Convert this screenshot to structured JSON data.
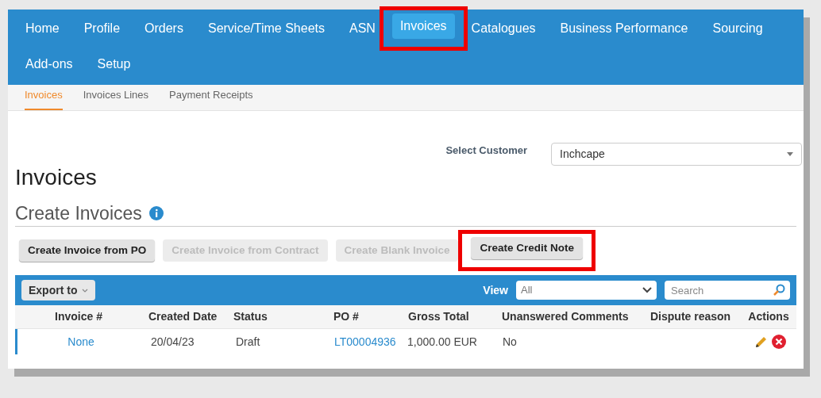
{
  "nav": {
    "items": [
      {
        "label": "Home",
        "selected": false,
        "highlighted": false
      },
      {
        "label": "Profile",
        "selected": false,
        "highlighted": false
      },
      {
        "label": "Orders",
        "selected": false,
        "highlighted": false
      },
      {
        "label": "Service/Time Sheets",
        "selected": false,
        "highlighted": false
      },
      {
        "label": "ASN",
        "selected": false,
        "highlighted": false
      },
      {
        "label": "Invoices",
        "selected": true,
        "highlighted": true
      },
      {
        "label": "Catalogues",
        "selected": false,
        "highlighted": false
      },
      {
        "label": "Business Performance",
        "selected": false,
        "highlighted": false
      },
      {
        "label": "Sourcing",
        "selected": false,
        "highlighted": false
      },
      {
        "label": "Add-ons",
        "selected": false,
        "highlighted": false
      },
      {
        "label": "Setup",
        "selected": false,
        "highlighted": false
      }
    ]
  },
  "subtabs": [
    {
      "label": "Invoices",
      "selected": true
    },
    {
      "label": "Invoices Lines",
      "selected": false
    },
    {
      "label": "Payment Receipts",
      "selected": false
    }
  ],
  "customer": {
    "label": "Select Customer",
    "value": "Inchcape"
  },
  "page_title": "Invoices",
  "section_title": "Create Invoices",
  "buttons": [
    {
      "label": "Create Invoice from PO",
      "disabled": false,
      "highlighted": false
    },
    {
      "label": "Create Invoice from Contract",
      "disabled": true,
      "highlighted": false
    },
    {
      "label": "Create Blank Invoice",
      "disabled": true,
      "highlighted": false
    },
    {
      "label": "Create Credit Note",
      "disabled": false,
      "highlighted": true
    }
  ],
  "toolbar": {
    "export": "Export to",
    "view_label": "View",
    "view_value": "All",
    "search_placeholder": "Search"
  },
  "table": {
    "columns": [
      "Invoice #",
      "Created Date",
      "Status",
      "PO #",
      "Gross Total",
      "Unanswered Comments",
      "Dispute reason",
      "Actions"
    ],
    "rows": [
      {
        "invoice": "None",
        "created": "20/04/23",
        "status": "Draft",
        "po": "LT00004936",
        "gross": "1,000.00 EUR",
        "unanswered": "No"
      }
    ]
  }
}
